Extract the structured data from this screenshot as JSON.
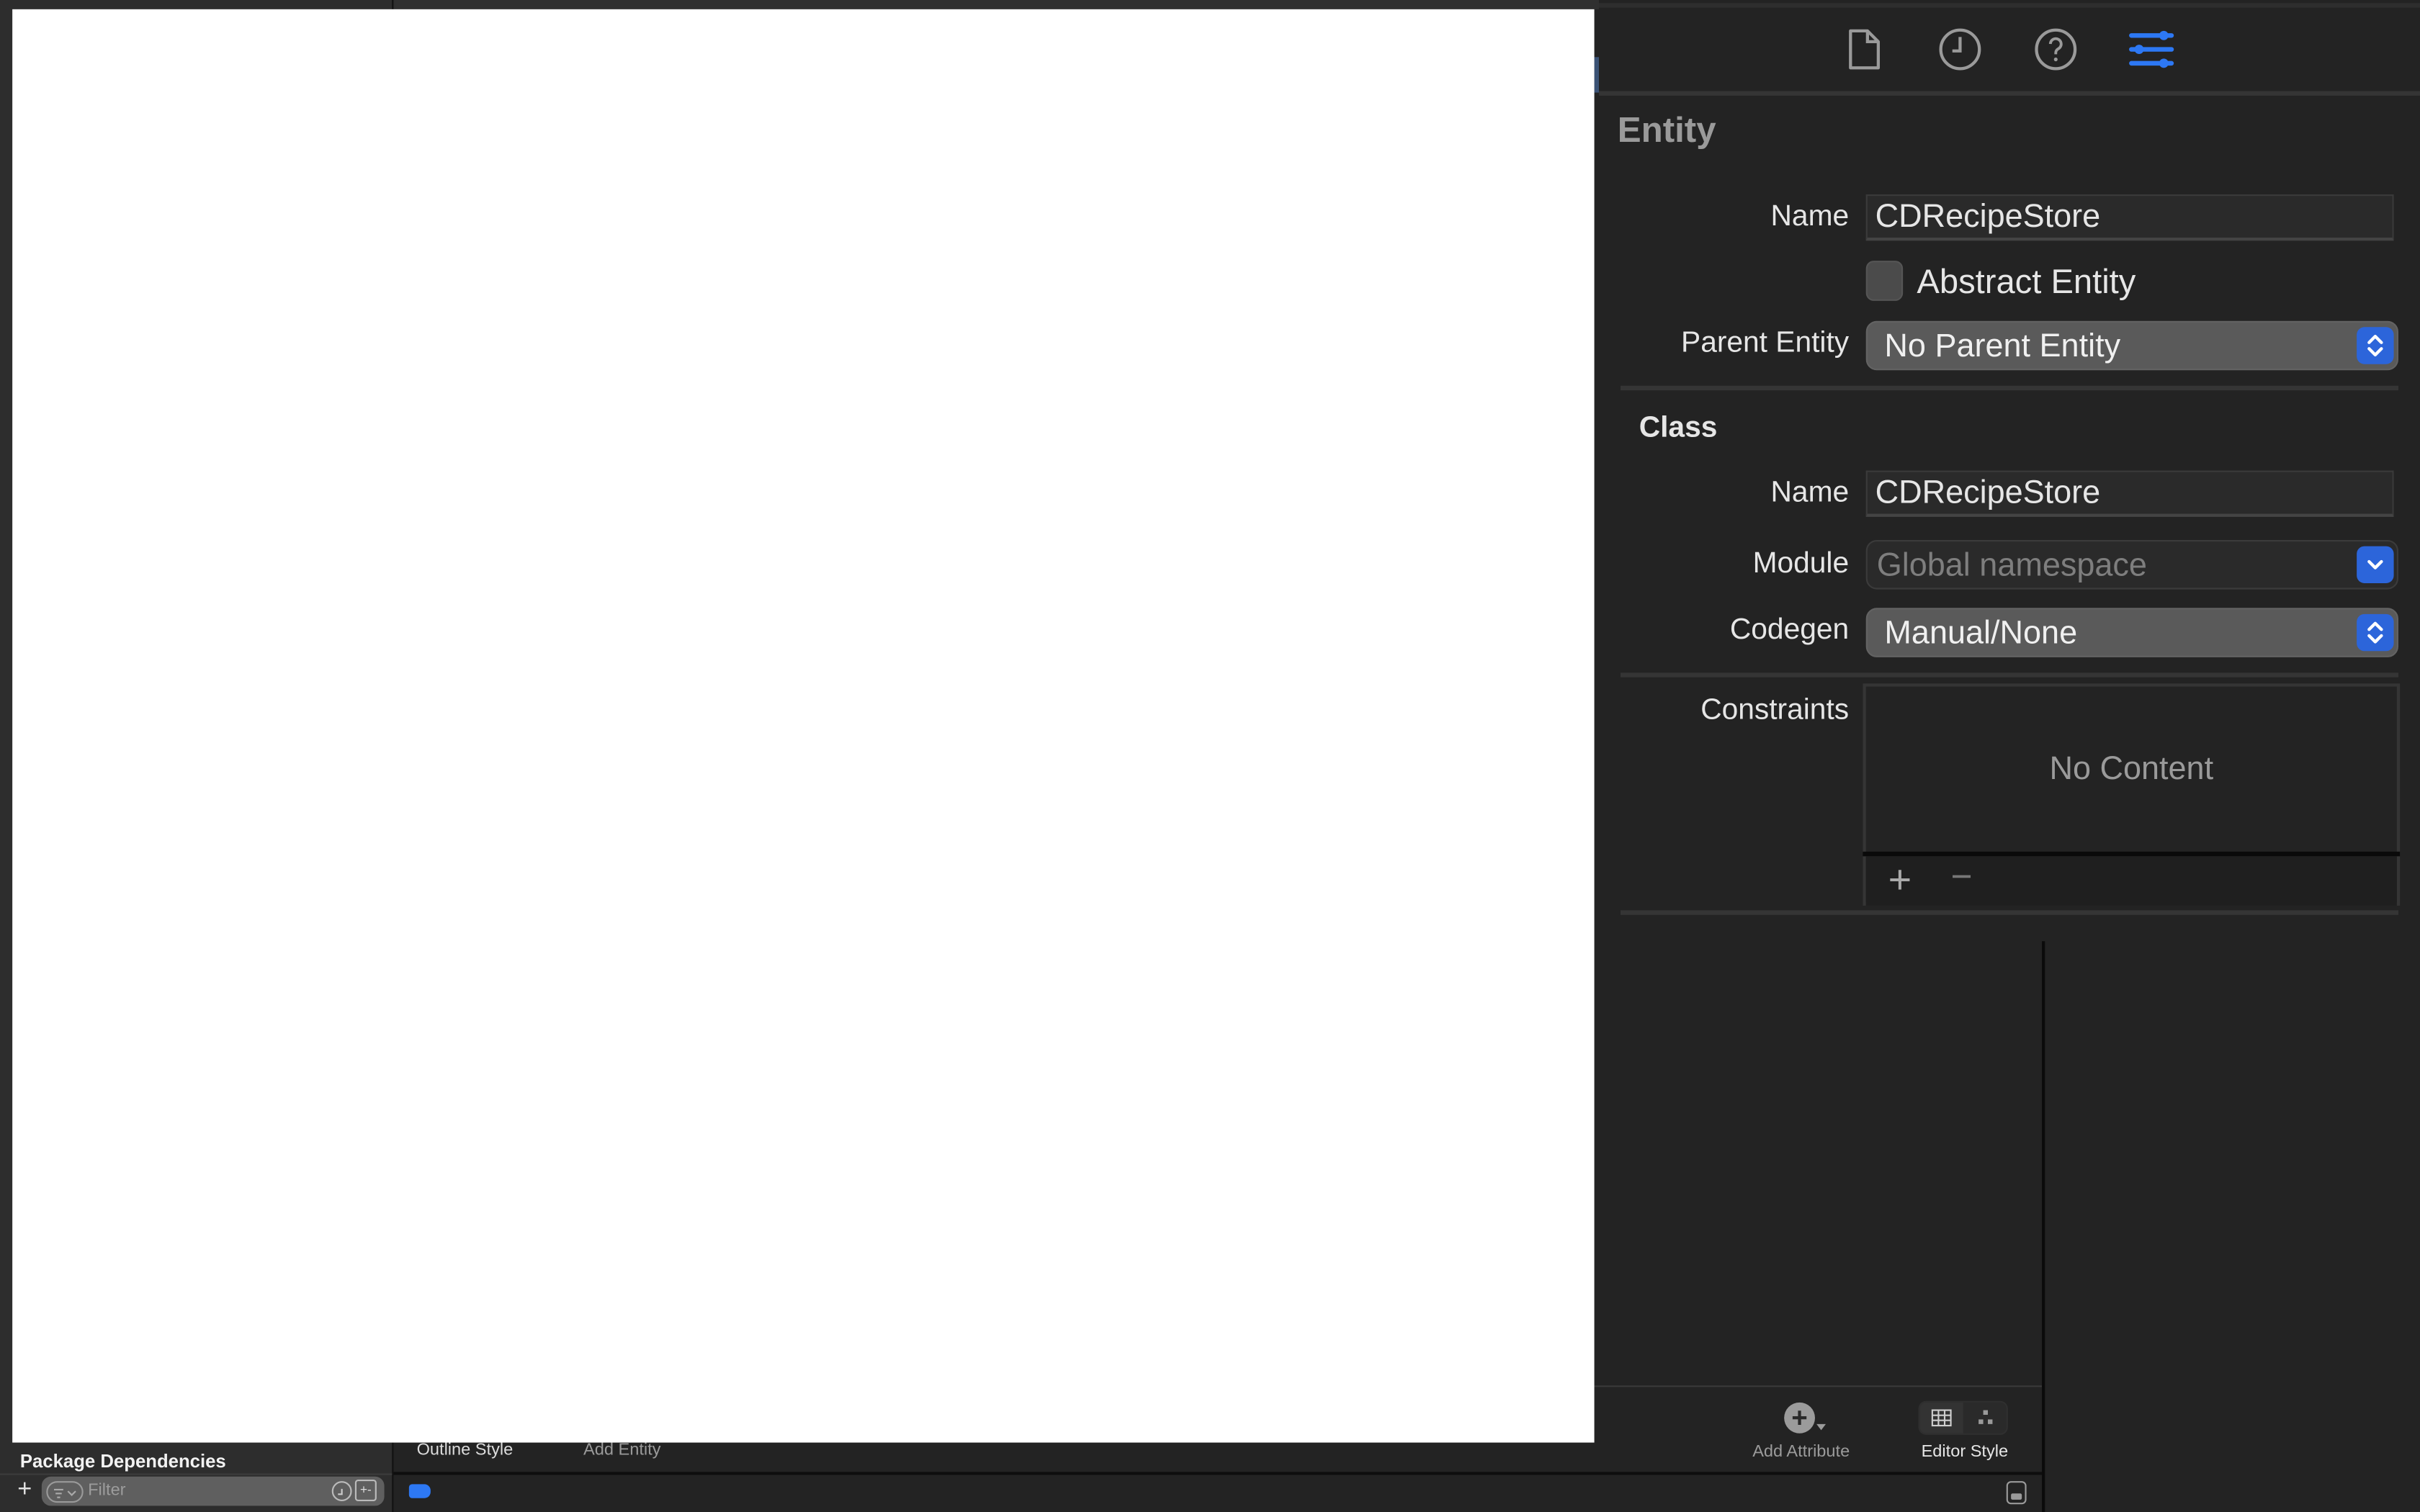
{
  "inspector": {
    "tabs": [
      {
        "id": "file",
        "icon": "file-icon",
        "active": false
      },
      {
        "id": "history",
        "icon": "clock-icon",
        "active": false
      },
      {
        "id": "help",
        "icon": "help-icon",
        "active": false
      },
      {
        "id": "data-model",
        "icon": "sliders-icon",
        "active": true
      }
    ],
    "entity": {
      "title": "Entity",
      "name_label": "Name",
      "name_value": "CDRecipeStore",
      "abstract_label": "Abstract Entity",
      "abstract_checked": false,
      "parent_label": "Parent Entity",
      "parent_value": "No Parent Entity"
    },
    "class": {
      "title": "Class",
      "name_label": "Name",
      "name_value": "CDRecipeStore",
      "module_label": "Module",
      "module_placeholder": "Global namespace",
      "codegen_label": "Codegen",
      "codegen_value": "Manual/None"
    },
    "constraints": {
      "label": "Constraints",
      "empty_text": "No Content",
      "add_label": "+",
      "remove_label": "−"
    }
  },
  "editor": {
    "outline_style_label": "Outline Style",
    "add_entity_label": "Add Entity",
    "add_attribute_label": "Add Attribute",
    "editor_style_label": "Editor Style"
  },
  "navigator": {
    "footer_title": "Package Dependencies",
    "add_label": "+",
    "filter_placeholder": "Filter"
  },
  "colors": {
    "accent": "#2d78f4",
    "popup_button": "#2c65da",
    "background": "#232323"
  }
}
